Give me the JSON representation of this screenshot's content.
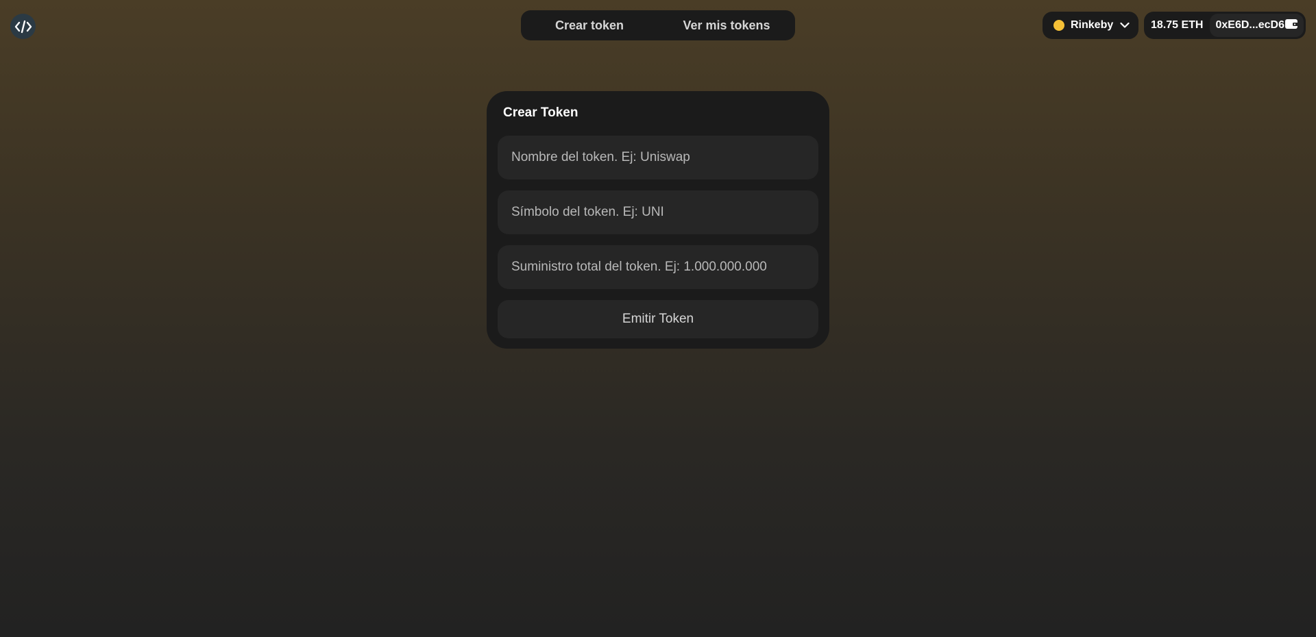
{
  "header": {
    "logo_icon": "code-brackets-icon",
    "nav_tabs": [
      {
        "label": "Crear token"
      },
      {
        "label": "Ver mis tokens"
      }
    ],
    "network": {
      "label": "Rinkeby",
      "status_color": "#f5c036",
      "icon": "chevron-down-icon"
    },
    "account": {
      "balance": "18.75 ETH",
      "address": "0xE6D...ecD6",
      "icon": "wallet-icon"
    }
  },
  "card": {
    "title": "Crear Token",
    "name_placeholder": "Nombre del token. Ej: Uniswap",
    "symbol_placeholder": "Símbolo del token. Ej: UNI",
    "supply_placeholder": "Suministro total del token. Ej: 1.000.000.000",
    "submit_label": "Emitir Token"
  }
}
